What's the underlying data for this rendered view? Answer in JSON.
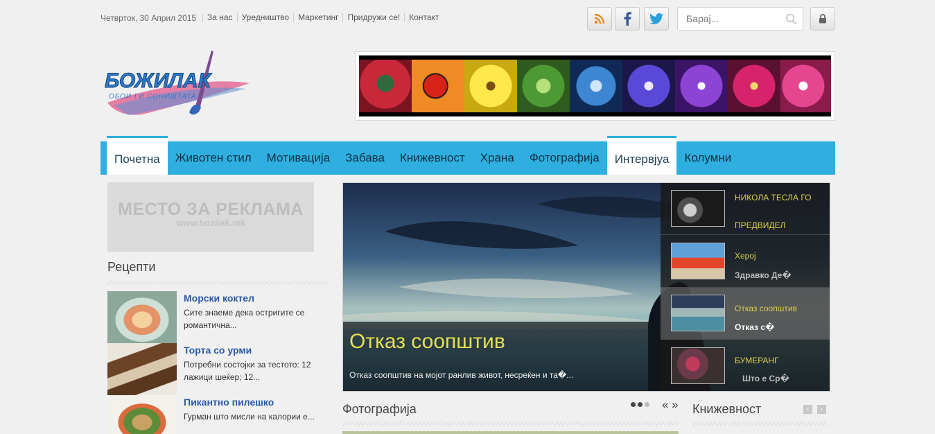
{
  "top": {
    "date": "Четврток, 30 Април 2015",
    "links": [
      "За нас",
      "Уредништво",
      "Маркетинг",
      "Придружи се!",
      "Контакт"
    ],
    "search_placeholder": "Барај..."
  },
  "icons": {
    "rss": "rss-icon",
    "facebook": "facebook-icon",
    "twitter": "twitter-icon",
    "search": "search-icon",
    "lock": "lock-icon"
  },
  "colors": {
    "nav": "#2eafe0",
    "link": "#2b5aa8",
    "caption_title": "#e6df53",
    "thumb_title": "#d9cf4c"
  },
  "logo": {
    "text": "БОЖИЛАК",
    "tagline": "ОБОИ ГИ СОНИШТАТА"
  },
  "nav": {
    "items": [
      "Почетна",
      "Животен стил",
      "Мотивација",
      "Забава",
      "Книжевност",
      "Храна",
      "Фотографија",
      "Интервјуа",
      "Колумни"
    ],
    "active": [
      "Почетна",
      "Интервјуа"
    ]
  },
  "ad": {
    "title": "МЕСТО ЗА РЕКЛАМА",
    "url": "www.bozilak.mk"
  },
  "recipes": {
    "title": "Рецепти",
    "items": [
      {
        "title": "Морски коктел",
        "text": "Сите знаеме дека остригите се романтична..."
      },
      {
        "title": "Торта со урми",
        "text": "Потребни состојки за тестото:   12 лажици шеќер; 12..."
      },
      {
        "title": "Пикантно пилешко",
        "text": "Гурман што мисли на калории е..."
      }
    ]
  },
  "slider": {
    "caption_title": "Отказ соопштив",
    "caption_text": "Отказ соопштив на мојот ранлив живот, несреќен и та�...",
    "thumbs": [
      {
        "title": "НИКОЛА ТЕСЛА ГО",
        "title2": "ПРЕДВИДЕЛ",
        "sub": ""
      },
      {
        "title": "Херој",
        "title2": "",
        "sub": "Здравко Де�"
      },
      {
        "title": "Отказ соопштив",
        "title2": "",
        "sub": "Отказ с�"
      },
      {
        "title": "БУМЕРАНГ",
        "title2": "",
        "sub": "Што е Ср�"
      }
    ]
  },
  "sections": {
    "photography": "Фотографија",
    "literature": "Книжевност"
  },
  "controls": {
    "prev_next": "« »",
    "left": "‹",
    "right": "›"
  }
}
